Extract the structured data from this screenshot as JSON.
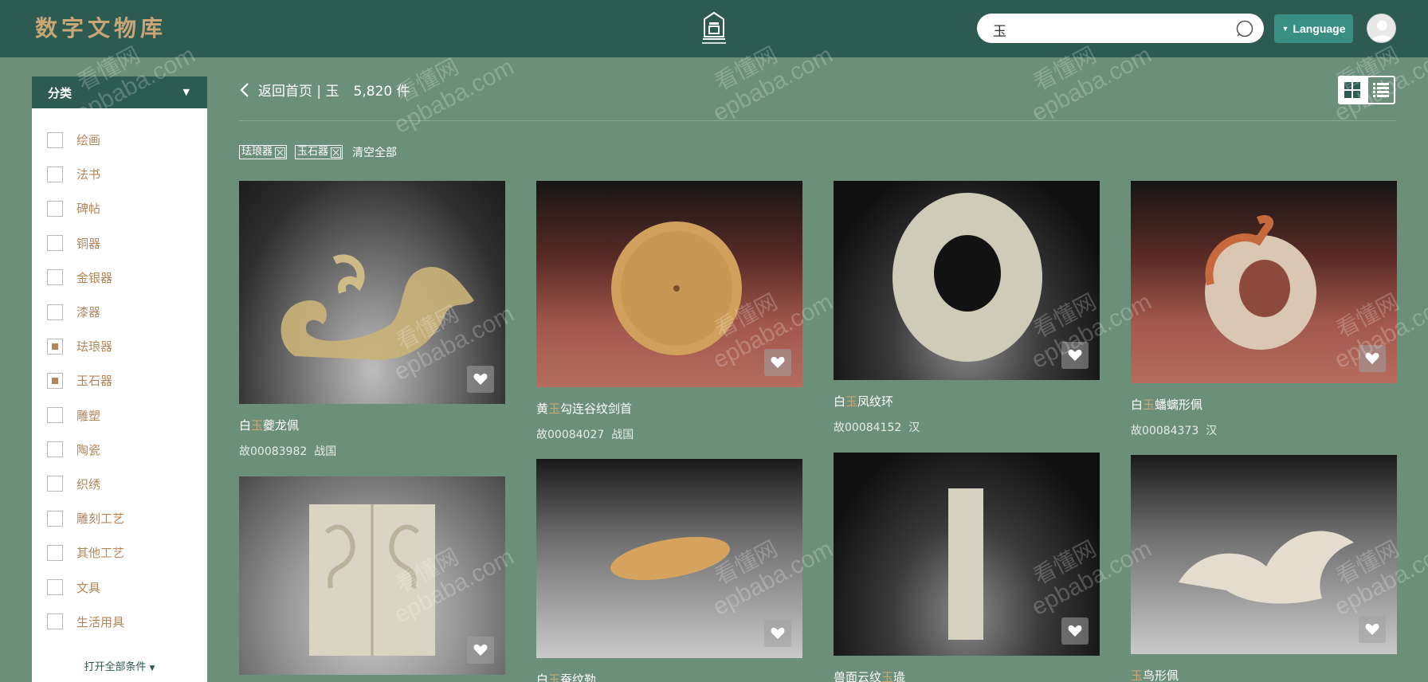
{
  "header": {
    "brand": "数字文物库",
    "search_value": "玉",
    "language_label": "Language"
  },
  "sidebar": {
    "title": "分类",
    "categories": [
      {
        "label": "绘画",
        "checked": false
      },
      {
        "label": "法书",
        "checked": false
      },
      {
        "label": "碑帖",
        "checked": false
      },
      {
        "label": "铜器",
        "checked": false
      },
      {
        "label": "金银器",
        "checked": false
      },
      {
        "label": "漆器",
        "checked": false
      },
      {
        "label": "珐琅器",
        "checked": true
      },
      {
        "label": "玉石器",
        "checked": true
      },
      {
        "label": "雕塑",
        "checked": false
      },
      {
        "label": "陶瓷",
        "checked": false
      },
      {
        "label": "织绣",
        "checked": false
      },
      {
        "label": "雕刻工艺",
        "checked": false
      },
      {
        "label": "其他工艺",
        "checked": false
      },
      {
        "label": "文具",
        "checked": false
      },
      {
        "label": "生活用具",
        "checked": false
      }
    ],
    "open_all": "打开全部条件"
  },
  "toolbar": {
    "back_label": "返回首页 | 玉",
    "count": "5,820 件"
  },
  "filters": {
    "tags": [
      "珐琅器",
      "玉石器"
    ],
    "clear_all": "清空全部"
  },
  "cards": [
    {
      "title_pre": "白",
      "title_hl": "玉",
      "title_post": "夔龙佩",
      "id": "故00083982",
      "period": "战国"
    },
    {
      "title_pre": "黄",
      "title_hl": "玉",
      "title_post": "勾连谷纹剑首",
      "id": "故00084027",
      "period": "战国"
    },
    {
      "title_pre": "白",
      "title_hl": "玉",
      "title_post": "凤纹环",
      "id": "故00084152",
      "period": "汉"
    },
    {
      "title_pre": "白",
      "title_hl": "玉",
      "title_post": "蟠螭形佩",
      "id": "故00084373",
      "period": "汉"
    },
    {
      "title_pre": "",
      "title_hl": "",
      "title_post": "",
      "id": "",
      "period": ""
    },
    {
      "title_pre": "白",
      "title_hl": "玉",
      "title_post": "蚕纹勒",
      "id": "",
      "period": ""
    },
    {
      "title_pre": "兽面云纹",
      "title_hl": "玉",
      "title_post": "璏",
      "id": "",
      "period": ""
    },
    {
      "title_pre": "",
      "title_hl": "玉",
      "title_post": "鸟形佩",
      "id": "",
      "period": ""
    }
  ],
  "watermark": {
    "cn": "看懂网",
    "en": "epbaba.com"
  },
  "colors": {
    "header_bg": "#2d5a51",
    "page_bg": "#6b8f79",
    "brand_gold": "#c9a676",
    "category_text": "#b2865a",
    "language_button": "#3a8f85"
  },
  "icons": [
    "search-icon",
    "chevron-left-icon",
    "grid-view-icon",
    "list-view-icon",
    "heart-icon",
    "caret-down-icon",
    "user-avatar-icon",
    "museum-logo-icon"
  ]
}
